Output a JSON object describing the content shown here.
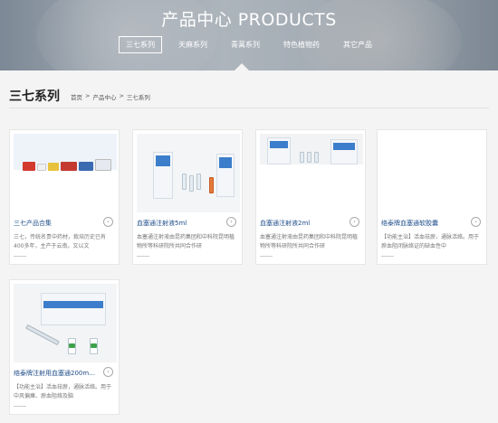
{
  "banner": {
    "title": "产品中心 PRODUCTS",
    "tabs": [
      {
        "label": "三七系列",
        "active": true
      },
      {
        "label": "天麻系列",
        "active": false
      },
      {
        "label": "青蒿系列",
        "active": false
      },
      {
        "label": "特色植物药",
        "active": false
      },
      {
        "label": "其它产品",
        "active": false
      }
    ]
  },
  "section": {
    "title": "三七系列",
    "breadcrumb": [
      "首页",
      ">",
      "产品中心",
      ">",
      "三七系列"
    ]
  },
  "products": [
    {
      "name": "三七产品合集",
      "desc": "三七，传统名贵中药材，栽培历史已有400多年，主产于云南。又以文"
    },
    {
      "name": "血塞通注射液5ml",
      "desc": "血塞通注射液由昆药集团和中科院昆明植物所等科研院所共同合作研"
    },
    {
      "name": "血塞通注射液2ml",
      "desc": "血塞通注射液由昆药集团和中科院昆明植物所等科研院所共同合作研"
    },
    {
      "name": "络泰牌血塞通软胶囊",
      "desc": "【功能主治】活血祛瘀，通脉活络。用于瘀血阻闭脉络证的缺血性中"
    },
    {
      "name": "络泰牌注射用血塞通200m…",
      "desc": "【功能主治】活血祛瘀，通脉活络。用于中风偏瘫、瘀血阻络及脑"
    }
  ],
  "colors": {
    "product_name": "#1e4c8a",
    "package_blue": "#3c7ecb",
    "package_orange": "#e57a3a"
  }
}
